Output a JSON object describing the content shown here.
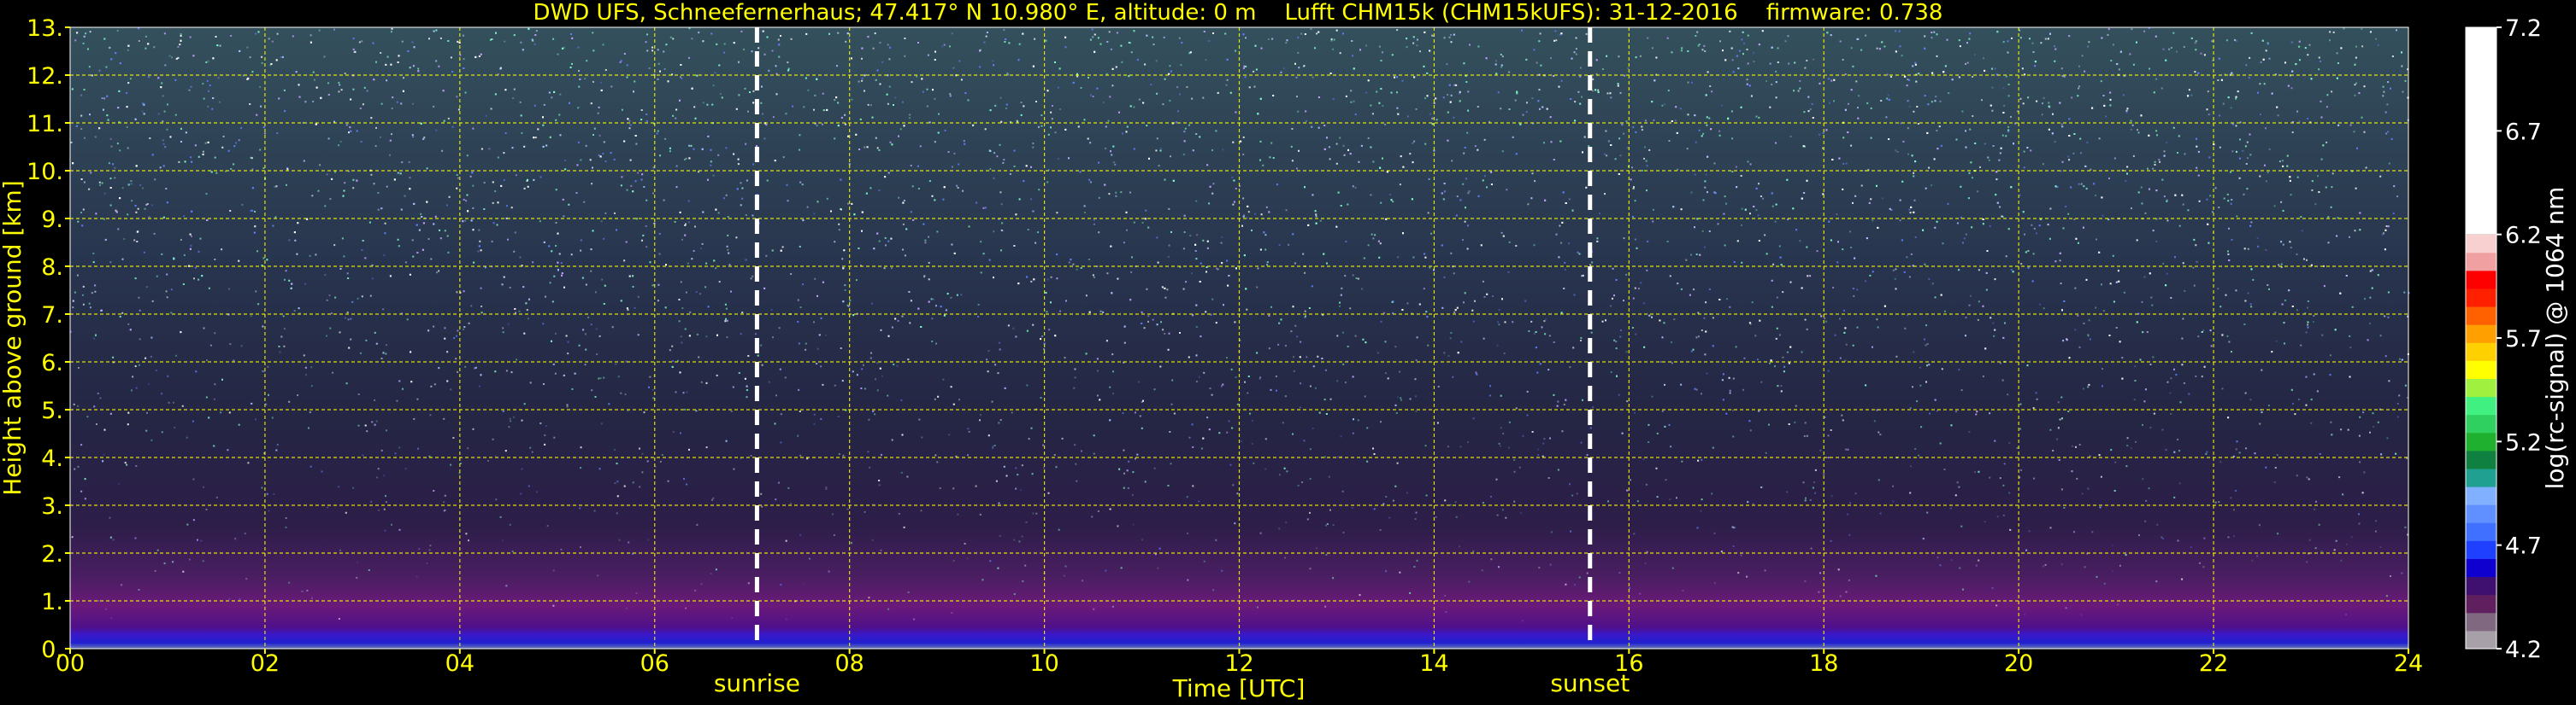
{
  "chart_data": {
    "type": "heatmap",
    "title": "DWD UFS, Schneefernerhaus; 47.417° N 10.980° E, altitude: 0 m    Lufft CHM15k (CHM15kUFS): 31-12-2016    firmware: 0.738",
    "xlabel": "Time [UTC]",
    "ylabel": "Height above ground [km]",
    "xlim": [
      0,
      24
    ],
    "ylim": [
      0,
      13
    ],
    "x_ticks": [
      "00",
      "02",
      "04",
      "06",
      "08",
      "10",
      "12",
      "14",
      "16",
      "18",
      "20",
      "22",
      "24"
    ],
    "y_ticks": [
      "0.",
      "1.",
      "2.",
      "3.",
      "4.",
      "5.",
      "6.",
      "7.",
      "8.",
      "9.",
      "10.",
      "11.",
      "12.",
      "13."
    ],
    "grid": true,
    "grid_color": "#ffff00",
    "markers": [
      {
        "label": "sunrise",
        "x": 7.05
      },
      {
        "label": "sunset",
        "x": 15.6
      }
    ],
    "colorbar": {
      "label": "log(rc-signal) @ 1064 nm",
      "range": [
        4.2,
        7.2
      ],
      "ticks": [
        "4.2",
        "4.7",
        "5.2",
        "5.7",
        "6.2",
        "6.7",
        "7.2"
      ],
      "colors": [
        "#a8a0a8",
        "#806880",
        "#602060",
        "#401070",
        "#1000d0",
        "#2040ff",
        "#4070ff",
        "#6090ff",
        "#80b0ff",
        "#20a090",
        "#108040",
        "#20b030",
        "#30d060",
        "#40f080",
        "#a0f040",
        "#ffff00",
        "#ffd000",
        "#ffa000",
        "#ff6000",
        "#ff2000",
        "#ff0000",
        "#f0a0a0",
        "#f8d0d0",
        "#ffffff"
      ]
    },
    "profile": [
      {
        "h": 0.0,
        "color": "#6a7ab0"
      },
      {
        "h": 0.12,
        "color": "#2020d0"
      },
      {
        "h": 0.3,
        "color": "#3a18c8"
      },
      {
        "h": 0.45,
        "color": "#50108a"
      },
      {
        "h": 0.9,
        "color": "#6a1a78"
      },
      {
        "h": 1.5,
        "color": "#4a1e62"
      },
      {
        "h": 2.6,
        "color": "#2c1e48"
      },
      {
        "h": 5.0,
        "color": "#242644"
      },
      {
        "h": 8.0,
        "color": "#28344e"
      },
      {
        "h": 13.0,
        "color": "#34505c"
      }
    ],
    "noise_colors": [
      "#ffffff",
      "#a8c8ff",
      "#80ffd0",
      "#6080ff",
      "#c0a0ff",
      "#ffffff",
      "#70e0b0"
    ]
  }
}
